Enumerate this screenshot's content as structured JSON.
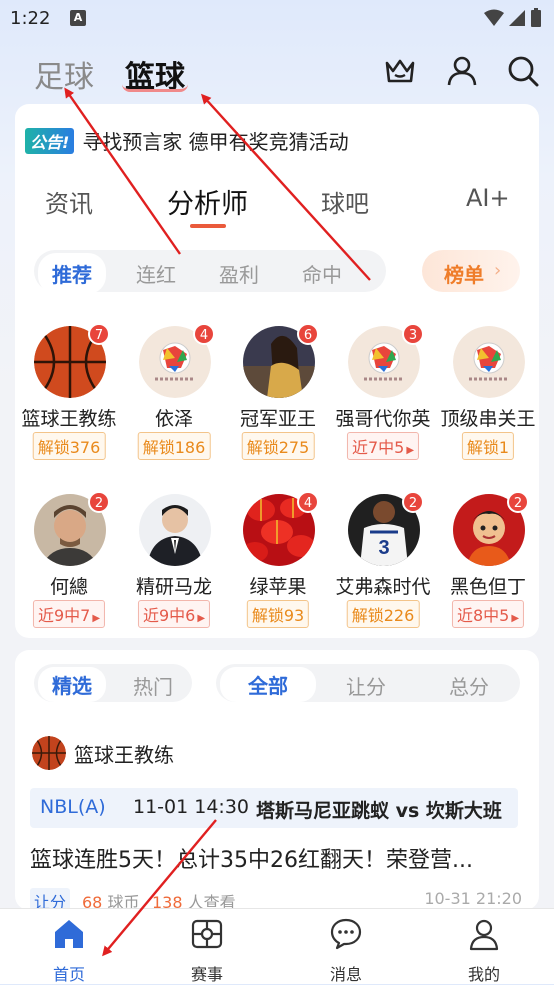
{
  "status": {
    "time": "1:22",
    "notif_letter": "A"
  },
  "top_nav": {
    "tabs": [
      {
        "label": "足球"
      },
      {
        "label": "篮球"
      }
    ],
    "icons": [
      "crown-icon",
      "user-icon",
      "search-icon"
    ]
  },
  "notice": {
    "badge": "公告!",
    "text": "寻找预言家 德甲有奖竞猜活动"
  },
  "sub_tabs": [
    {
      "label": "资讯"
    },
    {
      "label": "分析师"
    },
    {
      "label": "球吧"
    },
    {
      "label": "AI+"
    }
  ],
  "filters": [
    {
      "label": "推荐"
    },
    {
      "label": "连红"
    },
    {
      "label": "盈利"
    },
    {
      "label": "命中"
    }
  ],
  "rank_button": {
    "label": "榜单"
  },
  "analysts": [
    {
      "name": "篮球王教练",
      "badge": "7",
      "tag": "解锁376",
      "tag_type": "unlock",
      "avatar": "basketball"
    },
    {
      "name": "依泽",
      "badge": "4",
      "tag": "解锁186",
      "tag_type": "unlock",
      "avatar": "soccer-logo"
    },
    {
      "name": "冠军亚王",
      "badge": "6",
      "tag": "解锁275",
      "tag_type": "unlock",
      "avatar": "photo-woman"
    },
    {
      "name": "强哥代你英",
      "badge": "3",
      "tag": "近7中5",
      "tag_type": "streak",
      "avatar": "soccer-logo"
    },
    {
      "name": "顶级串关王",
      "badge": "",
      "tag": "解锁1",
      "tag_type": "unlock",
      "avatar": "soccer-logo"
    },
    {
      "name": "何總",
      "badge": "2",
      "tag": "近9中7",
      "tag_type": "streak",
      "avatar": "photo-man"
    },
    {
      "name": "精研马龙",
      "badge": "",
      "tag": "近9中6",
      "tag_type": "streak",
      "avatar": "photo-suit"
    },
    {
      "name": "绿苹果",
      "badge": "4",
      "tag": "解锁93",
      "tag_type": "unlock",
      "avatar": "lanterns"
    },
    {
      "name": "艾弗森时代",
      "badge": "2",
      "tag": "解锁226",
      "tag_type": "unlock",
      "avatar": "jersey"
    },
    {
      "name": "黑色但丁",
      "badge": "2",
      "tag": "近8中5",
      "tag_type": "streak",
      "avatar": "cartoon"
    }
  ],
  "feed": {
    "seg1": [
      {
        "label": "精选"
      },
      {
        "label": "热门"
      }
    ],
    "seg2": [
      {
        "label": "全部"
      },
      {
        "label": "让分"
      },
      {
        "label": "总分"
      }
    ],
    "post": {
      "author": "篮球王教练",
      "league": "NBL(A)",
      "time": "11-01 14:30",
      "teams": "塔斯马尼亚跳蚁 vs 坎斯大班",
      "title": "篮球连胜5天！总计35中26红翻天！荣登营...",
      "category": "让分",
      "coins_value": "68",
      "coins_unit": "球币",
      "views_value": "138",
      "views_unit": "人查看",
      "date": "10-31 21:20"
    }
  },
  "bottom_nav": [
    {
      "label": "首页"
    },
    {
      "label": "赛事"
    },
    {
      "label": "消息"
    },
    {
      "label": "我的"
    }
  ],
  "colors": {
    "accent": "#2f6bd8",
    "orange": "#ef7d2a",
    "red": "#e8453c",
    "arrow": "#e02020"
  }
}
